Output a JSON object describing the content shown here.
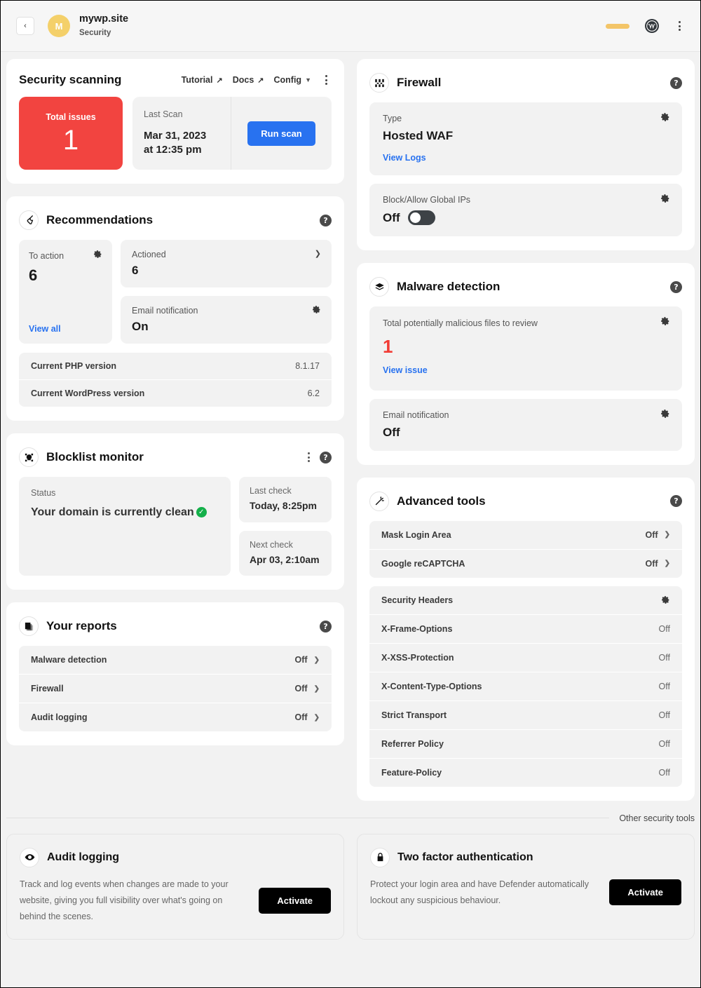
{
  "topbar": {
    "back_label": "‹",
    "avatar_letter": "M",
    "site_name": "mywp.site",
    "site_section": "Security",
    "wp_glyph": "W"
  },
  "security_scanning": {
    "title": "Security scanning",
    "actions": {
      "tutorial": "Tutorial",
      "docs": "Docs",
      "config": "Config"
    },
    "issues_label": "Total issues",
    "issues_count": "1",
    "last_scan_label": "Last Scan",
    "last_scan_date": "Mar 31, 2023",
    "last_scan_time": "at 12:35 pm",
    "run_scan": "Run scan",
    "accent_red": "#f24440",
    "accent_blue": "#2872f0"
  },
  "recommendations": {
    "title": "Recommendations",
    "to_action_label": "To action",
    "to_action_value": "6",
    "view_all": "View all",
    "actioned_label": "Actioned",
    "actioned_value": "6",
    "email_label": "Email notification",
    "email_value": "On",
    "versions": [
      {
        "label": "Current PHP version",
        "value": "8.1.17"
      },
      {
        "label": "Current WordPress version",
        "value": "6.2"
      }
    ]
  },
  "blocklist": {
    "title": "Blocklist monitor",
    "status_label": "Status",
    "status_value": "Your domain is currently clean",
    "last_check_label": "Last check",
    "last_check_value": "Today, 8:25pm",
    "next_check_label": "Next check",
    "next_check_value": "Apr 03, 2:10am",
    "status_color": "#14b04a"
  },
  "reports": {
    "title": "Your reports",
    "rows": [
      {
        "label": "Malware detection",
        "value": "Off"
      },
      {
        "label": "Firewall",
        "value": "Off"
      },
      {
        "label": "Audit logging",
        "value": "Off"
      }
    ]
  },
  "firewall": {
    "title": "Firewall",
    "type_label": "Type",
    "type_value": "Hosted WAF",
    "view_logs": "View Logs",
    "global_ips_label": "Block/Allow Global IPs",
    "global_ips_value": "Off"
  },
  "malware": {
    "title": "Malware detection",
    "total_label": "Total potentially malicious files to review",
    "total_value": "1",
    "view_issue": "View issue",
    "email_label": "Email notification",
    "email_value": "Off",
    "alert_color": "#f23c35"
  },
  "advanced_tools": {
    "title": "Advanced tools",
    "toggles": [
      {
        "label": "Mask Login Area",
        "value": "Off"
      },
      {
        "label": "Google reCAPTCHA",
        "value": "Off"
      }
    ],
    "headers_label": "Security Headers",
    "headers": [
      {
        "label": "X-Frame-Options",
        "value": "Off"
      },
      {
        "label": "X-XSS-Protection",
        "value": "Off"
      },
      {
        "label": "X-Content-Type-Options",
        "value": "Off"
      },
      {
        "label": "Strict Transport",
        "value": "Off"
      },
      {
        "label": "Referrer Policy",
        "value": "Off"
      },
      {
        "label": "Feature-Policy",
        "value": "Off"
      }
    ]
  },
  "other_tools": {
    "divider_label": "Other security tools",
    "audit": {
      "title": "Audit logging",
      "text": "Track and log events when changes are made to your website, giving you full visibility over what's going on behind the scenes.",
      "button": "Activate"
    },
    "twofactor": {
      "title": "Two factor authentication",
      "text": "Protect your login area and have Defender automatically lockout any suspicious behaviour.",
      "button": "Activate"
    }
  }
}
